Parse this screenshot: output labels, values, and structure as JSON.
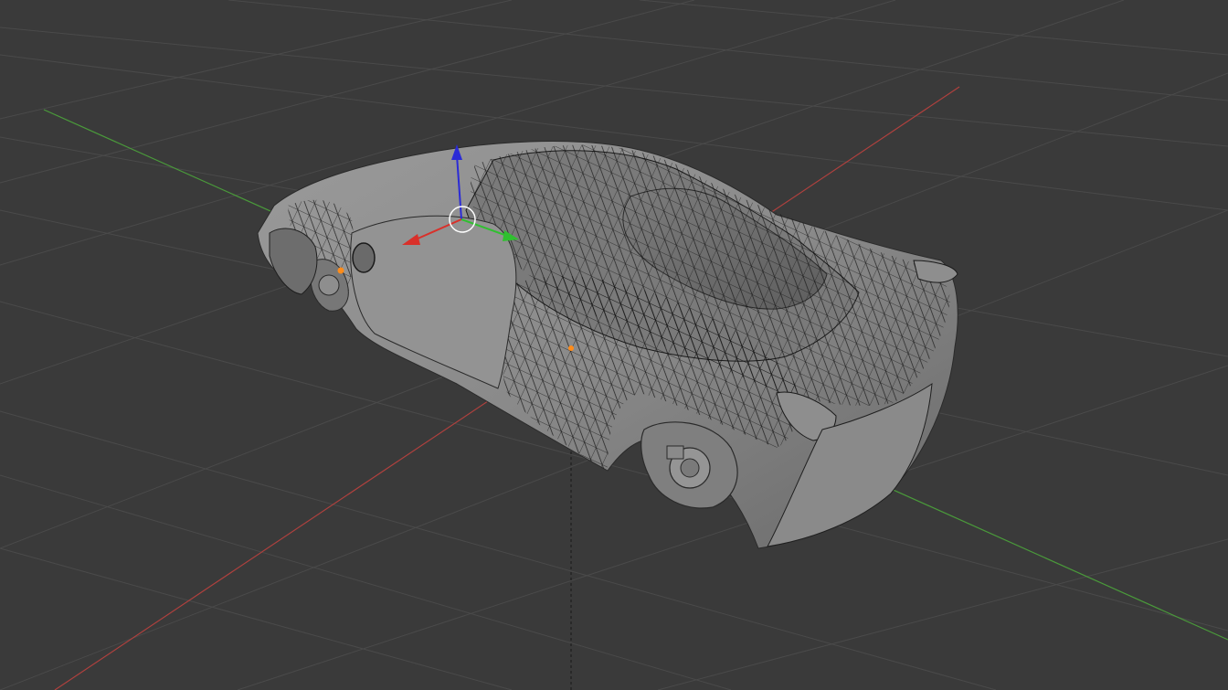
{
  "viewport": {
    "background_color": "#3a3a3a",
    "grid_color": "#4a4a4a",
    "axis_colors": {
      "x_axis": "#b0413e",
      "y_axis": "#4a9a3a",
      "z_axis": "#2b2bd6"
    },
    "object": {
      "name_visible": "",
      "shading": "solid-gray",
      "body_color": "#8a8a8a",
      "wireframe_color": "#111111"
    },
    "gizmo": {
      "type": "translate",
      "x_handle_color": "#d9302a",
      "y_handle_color": "#30c030",
      "z_handle_color": "#2b2bd6",
      "center_ring_color": "#ffffff"
    },
    "origin_markers_color": "#ff8c1a",
    "icons": [
      "translate-gizmo-icon",
      "origin-dot-icon"
    ]
  }
}
